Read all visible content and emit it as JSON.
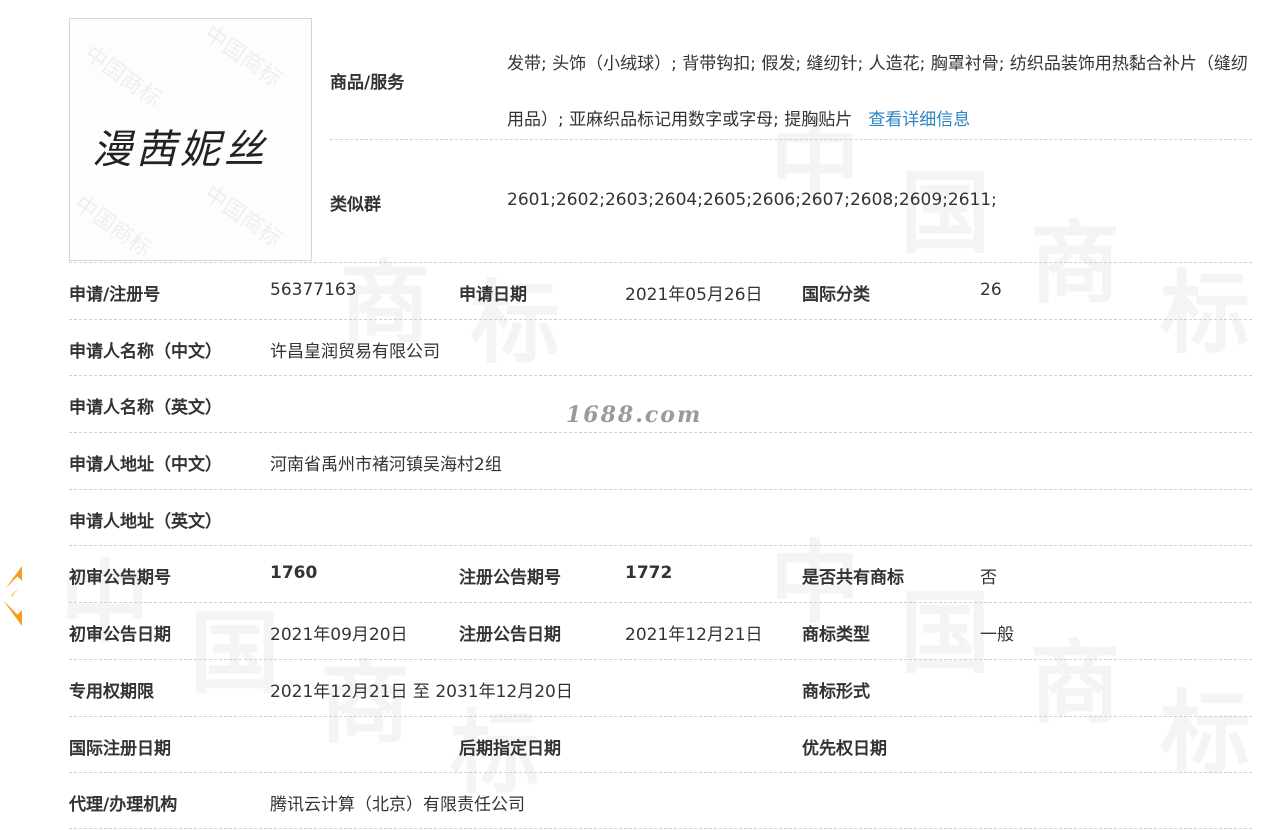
{
  "logo": {
    "mark_text": "漫茜妮丝",
    "watermark_text": "中国商标"
  },
  "goods": {
    "label": "商品/服务",
    "text": "发带; 头饰（小绒球）; 背带钩扣; 假发; 缝纫针; 人造花; 胸罩衬骨; 纺织品装饰用热黏合补片（缝纫用品）; 亚麻织品标记用数字或字母; 提胸贴片",
    "detail_link": "查看详细信息"
  },
  "similar_group": {
    "label": "类似群",
    "value": "2601;2602;2603;2604;2605;2606;2607;2608;2609;2611;"
  },
  "rows": [
    {
      "l1": "申请/注册号",
      "v1": "56377163",
      "l2": "申请日期",
      "v2": "2021年05月26日",
      "l3": "国际分类",
      "v3": "26"
    },
    {
      "l1": "申请人名称（中文）",
      "v1": "许昌皇润贸易有限公司"
    },
    {
      "l1": "申请人名称（英文）",
      "v1": ""
    },
    {
      "l1": "申请人地址（中文）",
      "v1": "河南省禹州市褚河镇吴海村2组"
    },
    {
      "l1": "申请人地址（英文）",
      "v1": ""
    },
    {
      "l1": "初审公告期号",
      "v1": "1760",
      "l2": "注册公告期号",
      "v2": "1772",
      "l3": "是否共有商标",
      "v3": "否"
    },
    {
      "l1": "初审公告日期",
      "v1": "2021年09月20日",
      "l2": "注册公告日期",
      "v2": "2021年12月21日",
      "l3": "商标类型",
      "v3": "一般"
    },
    {
      "l1": "专用权期限",
      "v1": "2021年12月21日 至 2031年12月20日",
      "l3": "商标形式",
      "v3": ""
    },
    {
      "l1": "国际注册日期",
      "v1": "",
      "l2": "后期指定日期",
      "v2": "",
      "l3": "优先权日期",
      "v3": ""
    },
    {
      "l1": "代理/办理机构",
      "v1": "腾讯云计算（北京）有限责任公司"
    }
  ],
  "watermark": {
    "site": "1688.com",
    "chars": [
      "中",
      "国",
      "商",
      "标"
    ]
  },
  "colors": {
    "link": "#2b86c5",
    "arrow": "#f79a1e",
    "divider": "#d0d0d0"
  },
  "icons": {
    "side_arrow": "chevron-left-icon"
  }
}
